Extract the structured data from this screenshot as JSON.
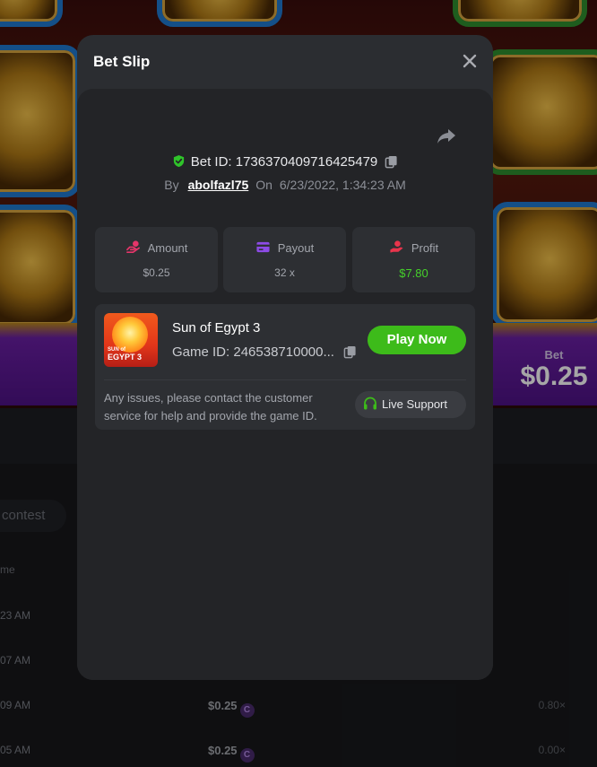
{
  "background": {
    "bet_label": "Bet",
    "bet_value": "$0.25",
    "filter_chip": "contest",
    "column_header": "me",
    "rows": [
      {
        "time": "23 AM",
        "amount": "",
        "multiplier": ""
      },
      {
        "time": "07 AM",
        "amount": "",
        "multiplier": ""
      },
      {
        "time": "09 AM",
        "amount": "$0.25",
        "multiplier": "0.80×"
      },
      {
        "time": "05 AM",
        "amount": "$0.25",
        "multiplier": "0.00×"
      }
    ],
    "coin_glyph": "C"
  },
  "modal": {
    "title": "Bet Slip",
    "close_icon": "close-icon",
    "share_icon": "share-icon",
    "bet_id_label": "Bet ID:",
    "bet_id": "1736370409716425479",
    "by_label": "By",
    "username": "abolfazl75",
    "on_label": "On",
    "datetime": "6/23/2022, 1:34:23 AM",
    "stats": {
      "amount": {
        "label": "Amount",
        "value": "$0.25"
      },
      "payout": {
        "label": "Payout",
        "value": "32 x"
      },
      "profit": {
        "label": "Profit",
        "value": "$7.80"
      }
    },
    "game": {
      "name": "Sun of Egypt 3",
      "id_label": "Game ID:",
      "id_value": "246538710000...",
      "thumb_line1": "SUN of",
      "thumb_line2": "EGYPT 3",
      "play_label": "Play Now",
      "help_text": "Any issues, please contact the customer service for help and provide the game ID.",
      "support_label": "Live Support"
    }
  },
  "colors": {
    "accent_green": "#3dbb1a",
    "profit_green": "#45d02b",
    "amount_icon": "#e6356a",
    "payout_icon": "#8d4be6",
    "profit_icon": "#e8354c",
    "verified_icon": "#2fc42a"
  }
}
